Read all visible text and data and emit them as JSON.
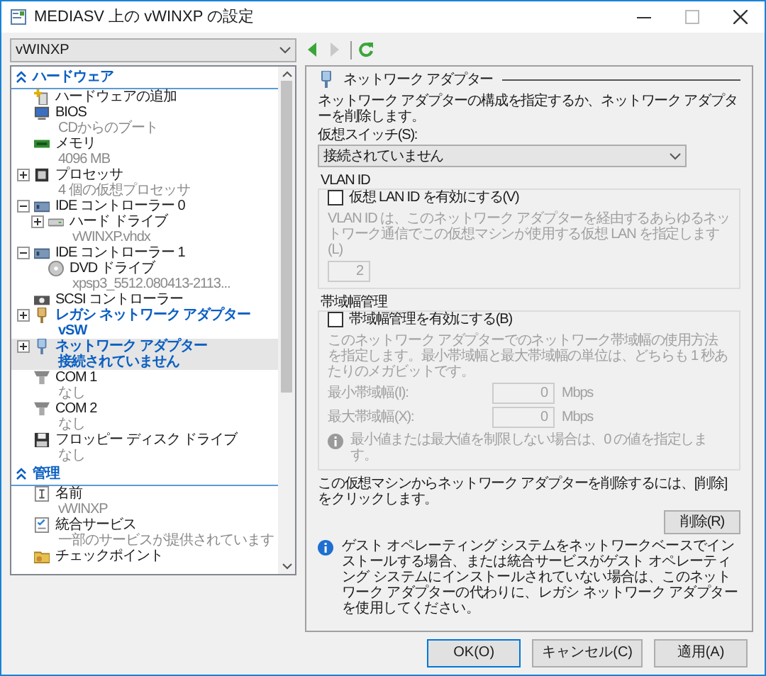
{
  "window": {
    "title": "MEDIASV 上の vWINXP の設定"
  },
  "vm_selector": {
    "value": "vWINXP"
  },
  "tree": {
    "sections": [
      {
        "label": "ハードウェア",
        "expanded": true,
        "items": [
          {
            "kind": "add",
            "label": "ハードウェアの追加",
            "selected": false
          },
          {
            "kind": "bios",
            "label": "BIOS",
            "detail": "CDからのブート",
            "selected": false
          },
          {
            "kind": "memory",
            "label": "メモリ",
            "detail": "4096 MB",
            "selected": false
          },
          {
            "kind": "processor",
            "label": "プロセッサ",
            "detail": "4 個の仮想プロセッサ",
            "expanded": false,
            "selected": false
          },
          {
            "kind": "ide",
            "label": "IDE コントローラー 0",
            "expanded": true,
            "selected": false,
            "children": [
              {
                "kind": "disk",
                "label": "ハード ドライブ",
                "detail": "vWINXP.vhdx",
                "expanded": false,
                "selected": false
              }
            ]
          },
          {
            "kind": "ide",
            "label": "IDE コントローラー 1",
            "expanded": true,
            "selected": false,
            "children": [
              {
                "kind": "dvd",
                "label": "DVD ドライブ",
                "detail": "xpsp3_5512.080413-2113...",
                "selected": false
              }
            ]
          },
          {
            "kind": "scsi",
            "label": "SCSI コントローラー",
            "selected": false
          },
          {
            "kind": "legacy",
            "label": "レガシ ネットワーク アダプター",
            "detail": "vSW",
            "expanded": false,
            "emphasized": true,
            "selected": false
          },
          {
            "kind": "network",
            "label": "ネットワーク アダプター",
            "detail": "接続されていません",
            "expanded": false,
            "emphasized": true,
            "selected": true
          },
          {
            "kind": "com",
            "label": "COM 1",
            "detail": "なし",
            "selected": false
          },
          {
            "kind": "com",
            "label": "COM 2",
            "detail": "なし",
            "selected": false
          },
          {
            "kind": "floppy",
            "label": "フロッピー ディスク ドライブ",
            "detail": "なし",
            "selected": false
          }
        ]
      },
      {
        "label": "管理",
        "expanded": true,
        "items": [
          {
            "kind": "name",
            "label": "名前",
            "detail": "vWINXP",
            "selected": false
          },
          {
            "kind": "integration",
            "label": "統合サービス",
            "detail": "一部のサービスが提供されています",
            "selected": false
          },
          {
            "kind": "checkpoint",
            "label": "チェックポイント",
            "selected": false
          }
        ]
      }
    ]
  },
  "toolbar": [
    {
      "kind": "back",
      "disabled": false
    },
    {
      "kind": "forward",
      "disabled": true
    },
    {
      "kind": "refresh",
      "disabled": false
    }
  ],
  "panel": {
    "heading": "ネットワーク アダプター",
    "description": "ネットワーク アダプターの構成を指定するか、ネットワーク アダプターを削除します。",
    "switch_label": "仮想スイッチ(S):",
    "switch_value": "接続されていません",
    "vlan": {
      "legend": "VLAN ID",
      "checkbox_label": "仮想 LAN ID を有効にする(V)",
      "checked": false,
      "disabled": true,
      "description": "VLAN ID は、このネットワーク アダプターを経由するあらゆるネットワーク通信でこの仮想マシンが使用する仮想 LAN を指定します(L)",
      "value": "2"
    },
    "bandwidth": {
      "legend": "帯域幅管理",
      "checkbox_label": "帯域幅管理を有効にする(B)",
      "checked": false,
      "disabled": true,
      "description": "このネットワーク アダプターでのネットワーク帯域幅の使用方法を指定します。最小帯域幅と最大帯域幅の単位は、どちらも 1 秒あたりのメガビットです。",
      "fields": [
        {
          "label": "最小帯域幅(I):",
          "value": "0",
          "unit": "Mbps"
        },
        {
          "label": "最大帯域幅(X):",
          "value": "0",
          "unit": "Mbps"
        }
      ],
      "note": "最小値または最大値を制限しない場合は、0 の値を指定します。"
    },
    "remove_text": "この仮想マシンからネットワーク アダプターを削除するには、[削除] をクリックします。",
    "remove_button": "削除(R)",
    "info": "ゲスト オペレーティング システムをネットワークベースでインストールする場合、または統合サービスがゲスト オペレーティング システムにインストールされていない場合は、このネットワーク アダプターの代わりに、レガシ ネットワーク アダプターを使用してください。"
  },
  "buttons": [
    {
      "label": "OK(O)",
      "default": true
    },
    {
      "label": "キャンセル(C)",
      "default": false
    },
    {
      "label": "適用(A)",
      "default": false
    }
  ]
}
